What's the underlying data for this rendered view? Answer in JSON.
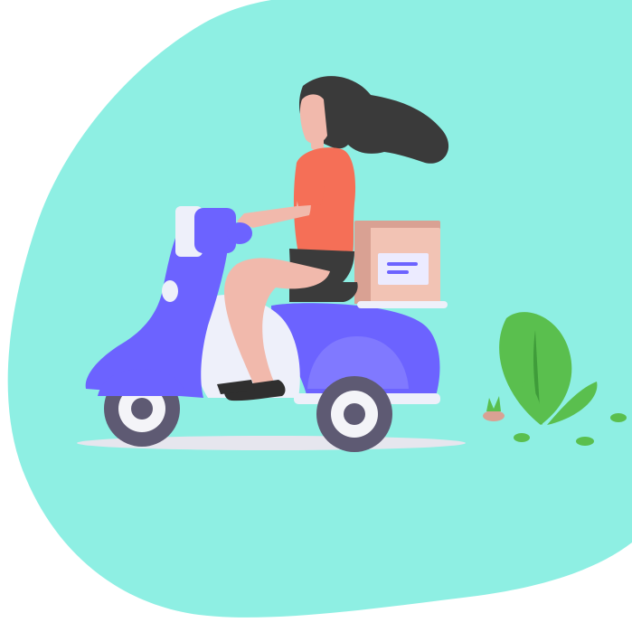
{
  "illustration": {
    "subject": "delivery-scooter-rider",
    "colors": {
      "blob": "#8EEFE3",
      "scooter": "#6C63FF",
      "scooter_light": "#8079FF",
      "scooter_white": "#EEF0FA",
      "wheel": "#5E5A73",
      "hub": "#F4F4F8",
      "hair": "#3A3A3A",
      "shirt": "#F56F57",
      "skin": "#F1B9AC",
      "shorts": "#3B3B3B",
      "shoe": "#2F2F2F",
      "box": "#F2C3B4",
      "box_shade": "#D9A193",
      "label": "#ECEBFF",
      "label_lines": "#6C63FF",
      "plant": "#5ABF4E",
      "plant_dark": "#3F9C3A",
      "ground_shadow": "#E6E6EE"
    },
    "icons": [
      "scooter-icon",
      "delivery-box-icon",
      "plant-icon"
    ]
  }
}
